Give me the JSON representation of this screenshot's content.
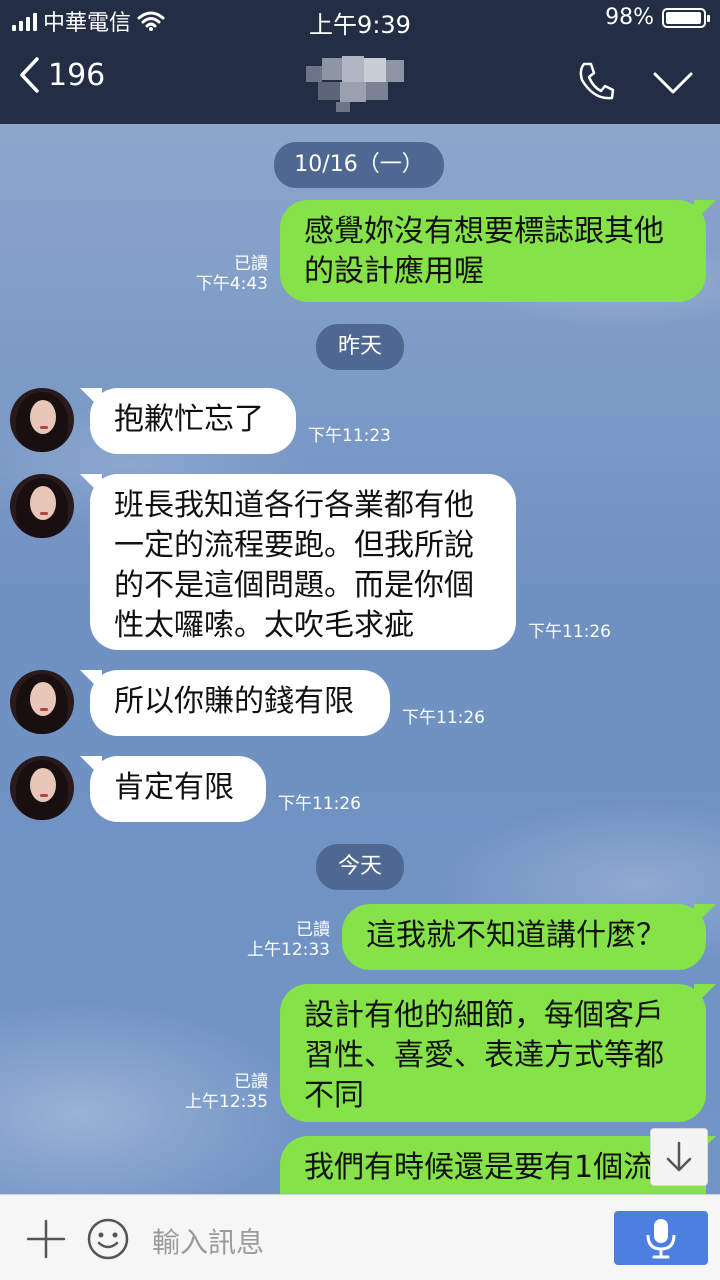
{
  "status_bar": {
    "carrier": "中華電信",
    "time": "上午9:39",
    "battery": "98%",
    "battery_level": 0.98
  },
  "header": {
    "back_count": "196",
    "icons": [
      "back-chevron-icon",
      "phone-icon",
      "chevron-down-icon"
    ]
  },
  "chat": {
    "dates": [
      "10/16（一）",
      "昨天",
      "今天"
    ],
    "messages": [
      {
        "from": "me",
        "lines": [
          "感覺妳沒有想要標誌跟其他",
          "的設計應用喔"
        ],
        "read": "已讀",
        "time": "下午4:43"
      },
      {
        "from": "them",
        "lines": [
          "抱歉忙忘了"
        ],
        "time": "下午11:23"
      },
      {
        "from": "them",
        "lines": [
          "班長我知道各行各業都有他",
          "一定的流程要跑。但我所說",
          "的不是這個問題。而是你個",
          "性太囉嗦。太吹毛求疵"
        ],
        "time": "下午11:26"
      },
      {
        "from": "them",
        "lines": [
          "所以你賺的錢有限"
        ],
        "time": "下午11:26"
      },
      {
        "from": "them",
        "lines": [
          "肯定有限"
        ],
        "time": "下午11:26"
      },
      {
        "from": "me",
        "lines": [
          "這我就不知道講什麼？"
        ],
        "read": "已讀",
        "time": "上午12:33"
      },
      {
        "from": "me",
        "lines": [
          "設計有他的細節，每個客戶",
          "習性、喜愛、表達方式等都",
          "不同"
        ],
        "read": "已讀",
        "time": "上午12:35"
      },
      {
        "from": "me",
        "lines": [
          "我們有時候還是要有1個流"
        ]
      }
    ]
  },
  "input": {
    "placeholder": "輸入訊息",
    "icons": [
      "plus-icon",
      "emoji-icon",
      "microphone-icon"
    ]
  },
  "colors": {
    "header_bg": "#232d44",
    "my_bubble": "#85e249",
    "their_bubble": "#ffffff",
    "date_pill": "#4e6891",
    "send_button": "#4d7fe0"
  }
}
